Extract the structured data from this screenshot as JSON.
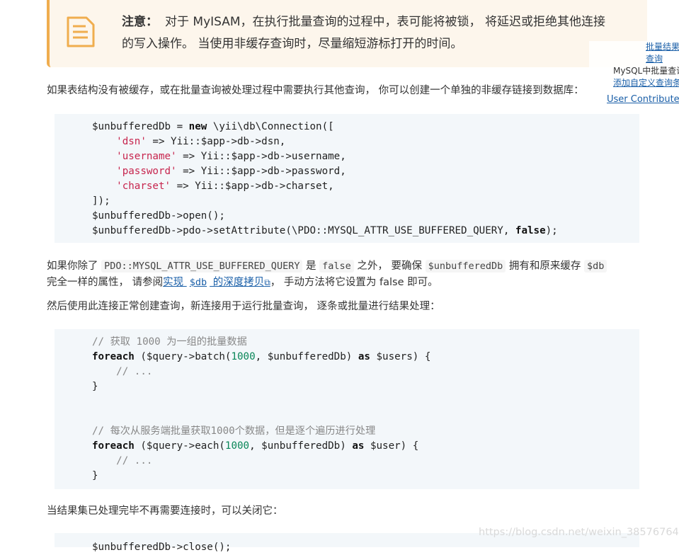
{
  "note": {
    "title": "注意：",
    "line1": "对于 MyISAM，在执行批量查询的过程中，表可能将被锁， 将延迟或拒绝其他连接",
    "line2": "的写入操作。 当使用非缓存查询时，尽量缩短游标打开的时间。"
  },
  "toc": {
    "item1": "批量结果",
    "item2": "查询",
    "item3": "MySQL中批量查询",
    "item4": "添加自定义查询条",
    "item5": "User Contributed"
  },
  "para1": "如果表结构没有被缓存，或在批量查询被处理过程中需要执行其他查询， 你可以创建一个单独的非缓存链接到数据库：",
  "code1": {
    "l1_var": "$unbufferedDb",
    "l1_eq": " = ",
    "l1_new": "new",
    "l1_rest": " \\yii\\db\\Connection([",
    "l2_key": "'dsn'",
    "l2_rest": " => Yii::$app->db->dsn,",
    "l3_key": "'username'",
    "l3_rest": " => Yii::$app->db->username,",
    "l4_key": "'password'",
    "l4_rest": " => Yii::$app->db->password,",
    "l5_key": "'charset'",
    "l5_rest": " => Yii::$app->db->charset,",
    "l6": "]);",
    "l7": "$unbufferedDb->open();",
    "l8_a": "$unbufferedDb->pdo->setAttribute(\\PDO::MYSQL_ATTR_USE_BUFFERED_QUERY, ",
    "l8_false": "false",
    "l8_b": ");"
  },
  "para2": {
    "t1": "如果你除了 ",
    "c1": "PDO::MYSQL_ATTR_USE_BUFFERED_QUERY",
    "t2": " 是 ",
    "c2": "false",
    "t3": " 之外， 要确保 ",
    "c3": "$unbufferedDb",
    "t4": " 拥有和原来缓存 ",
    "c4": "$db",
    "t5": "完全一样的属性， 请参阅",
    "link_a": "实现 ",
    "link_code": "$db",
    "link_b": " 的深度拷贝",
    "link_icon": "⧉",
    "t6": "， 手动方法将它设置为 false 即可。"
  },
  "para3": "然后使用此连接正常创建查询，新连接用于运行批量查询， 逐条或批量进行结果处理：",
  "code2": {
    "c1": "// 获取 1000 为一组的批量数据",
    "f1_kw": "foreach",
    "f1_a": " ($query->batch(",
    "f1_num": "1000",
    "f1_b": ", $unbufferedDb) ",
    "f1_as": "as",
    "f1_c": " $users) {",
    "dots1": "// ...",
    "close1": "}",
    "c2": "// 每次从服务端批量获取1000个数据，但是逐个遍历进行处理",
    "f2_kw": "foreach",
    "f2_a": " ($query->each(",
    "f2_num": "1000",
    "f2_b": ", $unbufferedDb) ",
    "f2_as": "as",
    "f2_c": " $user) {",
    "dots2": "// ...",
    "close2": "}"
  },
  "para4": "当结果集已处理完毕不再需要连接时，可以关闭它：",
  "code3": {
    "l1": "$unbufferedDb->close();"
  },
  "watermark": "https://blog.csdn.net/weixin_38576764",
  "colors": {
    "note_bg": "#fdf6ec",
    "note_border": "#f0ad4e",
    "code_bg": "#f3f7fa",
    "string": "#c7254e",
    "number": "#098658",
    "link": "#1a5fa8"
  }
}
